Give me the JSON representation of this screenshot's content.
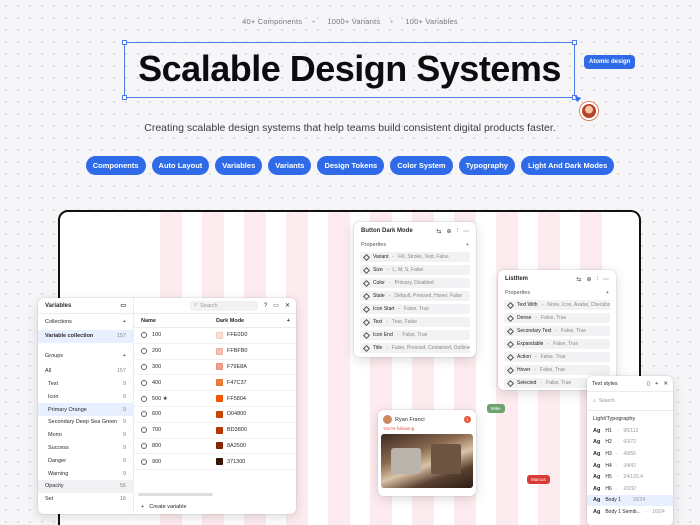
{
  "stats": [
    "40+ Components",
    "1000+ Variants",
    "100+ Variables"
  ],
  "title": "Scalable Design Systems",
  "atomic_tag": "Atomic design",
  "subtitle": "Creating scalable design systems that help teams build consistent digital products faster.",
  "chips": [
    "Components",
    "Auto Layout",
    "Variables",
    "Variants",
    "Design Tokens",
    "Color System",
    "Typography",
    "Light And Dark Modes"
  ],
  "colors": {
    "accent": "#2f6be8",
    "stripe": "#fdecef"
  },
  "variables_panel": {
    "title": "Variables",
    "collections_label": "Collections",
    "collection": {
      "label": "Variable collection",
      "count": "157"
    },
    "groups_label": "Groups",
    "groups": [
      {
        "label": "All",
        "count": "157"
      },
      {
        "label": "Text",
        "count": "9"
      },
      {
        "label": "Icon",
        "count": "9"
      },
      {
        "label": "Primary Orange",
        "count": "9"
      },
      {
        "label": "Secondary Deep Sea Green",
        "count": "9"
      },
      {
        "label": "Mono",
        "count": "9"
      },
      {
        "label": "Success",
        "count": "9"
      },
      {
        "label": "Danger",
        "count": "9"
      },
      {
        "label": "Warning",
        "count": "9"
      },
      {
        "label": "Opacity",
        "count": "56"
      },
      {
        "label": "Set",
        "count": "18"
      }
    ],
    "search_placeholder": "Search",
    "col_name": "Name",
    "col_mode": "Dark Mode",
    "rows": [
      {
        "name": "100",
        "value": "FFE0D0",
        "color": "#ffe0d0"
      },
      {
        "name": "200",
        "value": "FFBFB0",
        "color": "#ffbfb0"
      },
      {
        "name": "300",
        "value": "F79E8A",
        "color": "#f79e8a"
      },
      {
        "name": "400",
        "value": "F47C37",
        "color": "#f47c37"
      },
      {
        "name": "500 ★",
        "value": "FF5804",
        "color": "#ff5804"
      },
      {
        "name": "600",
        "value": "D04800",
        "color": "#d04800"
      },
      {
        "name": "700",
        "value": "BD3800",
        "color": "#bd3800"
      },
      {
        "name": "800",
        "value": "8A2500",
        "color": "#8a2500"
      },
      {
        "name": "900",
        "value": "371300",
        "color": "#371300"
      }
    ],
    "create_label": "Create variable"
  },
  "button_panel": {
    "title": "Button Dark Mode",
    "props_label": "Properties",
    "props": [
      {
        "k": "Variant",
        "v": "Fill, Stroke, Text, False"
      },
      {
        "k": "Size",
        "v": "L, M, S, False"
      },
      {
        "k": "Color",
        "v": "Primary, Disabled"
      },
      {
        "k": "State",
        "v": "Default, Pressed, Hover, False"
      },
      {
        "k": "Icon Start",
        "v": "False, True"
      },
      {
        "k": "Text",
        "v": "True, False"
      },
      {
        "k": "Icon End",
        "v": "False, True"
      },
      {
        "k": "Title",
        "v": "False, Pressed, Contained, Outlined, ..."
      }
    ]
  },
  "list_panel": {
    "title": "ListItem",
    "props_label": "Properties",
    "props": [
      {
        "k": "Text With",
        "v": "None, Icon, Avatar, Checkbox"
      },
      {
        "k": "Dense",
        "v": "False, True"
      },
      {
        "k": "Secondary Text",
        "v": "False, True"
      },
      {
        "k": "Expandable",
        "v": "False, True"
      },
      {
        "k": "Action",
        "v": "False, True"
      },
      {
        "k": "Hover",
        "v": "False, True"
      },
      {
        "k": "Selected",
        "v": "False, True"
      }
    ]
  },
  "card": {
    "name": "Ryan Franci",
    "sub": "You're following",
    "badge": "1"
  },
  "tag_green": "Mike",
  "tag_red": "Marcus",
  "text_styles": {
    "title": "Text styles",
    "search_placeholder": "Search",
    "group": "Light/Typography",
    "rows": [
      {
        "label": "H1",
        "size": "96/112"
      },
      {
        "label": "H2",
        "size": "60/72"
      },
      {
        "label": "H3",
        "size": "48/56"
      },
      {
        "label": "H4",
        "size": "34/42"
      },
      {
        "label": "H5",
        "size": "24/133.4"
      },
      {
        "label": "H6",
        "size": "20/32"
      },
      {
        "label": "Body 1",
        "size": "16/24"
      },
      {
        "label": "Body 1 Semib...",
        "size": "16/24"
      }
    ]
  }
}
